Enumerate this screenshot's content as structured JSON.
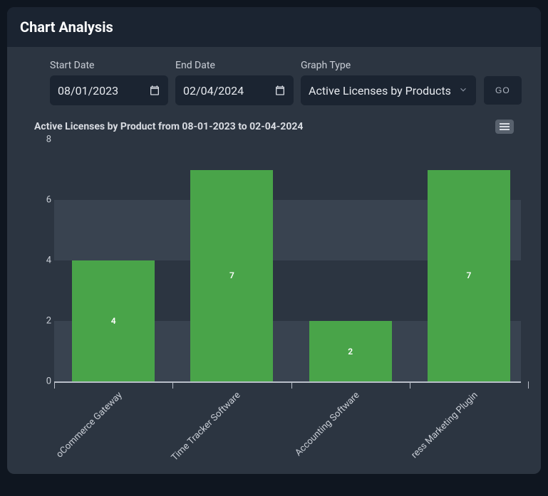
{
  "header": {
    "title": "Chart Analysis"
  },
  "controls": {
    "start_date_label": "Start Date",
    "start_date_value": "08/01/2023",
    "end_date_label": "End Date",
    "end_date_value": "02/04/2024",
    "graph_type_label": "Graph Type",
    "graph_type_value": "Active Licenses by Products",
    "go_label": "GO"
  },
  "chart": {
    "title": "Active Licenses by Product from 08-01-2023 to 02-04-2024"
  },
  "chart_data": {
    "type": "bar",
    "title": "Active Licenses by Product from 08-01-2023 to 02-04-2024",
    "categories": [
      "WooCommerce Gateway",
      "Time Tracker Software",
      "Accounting Software",
      "WordPress Marketing Plugin"
    ],
    "category_display": [
      "oCommerce Gateway",
      "Time Tracker Software",
      "Accounting Software",
      "ress Marketing Plugin"
    ],
    "values": [
      4,
      7,
      2,
      7
    ],
    "ylim": [
      0,
      8
    ],
    "yticks": [
      0,
      2,
      4,
      6,
      8
    ],
    "xlabel": "",
    "ylabel": "",
    "bar_color": "#49a449"
  }
}
